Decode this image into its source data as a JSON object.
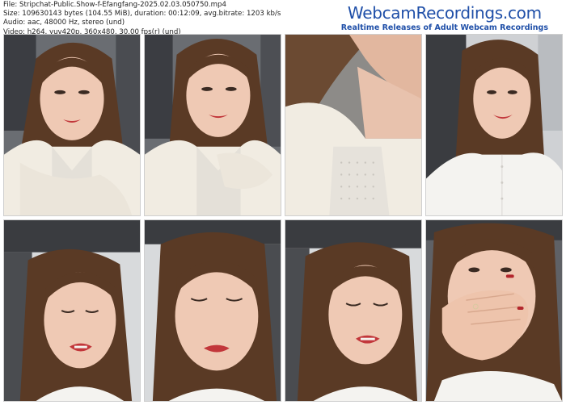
{
  "file_info": {
    "line1": "File: Stripchat-Public.Show-f-Efangfang-2025.02.03.050750.mp4",
    "line2": "Size: 109630143 bytes (104.55 MiB), duration: 00:12:09, avg.bitrate: 1203 kb/s",
    "line3": "Audio: aac, 48000 Hz, stereo (und)",
    "line4": "Video: h264, yuv420p, 360x480, 30.00 fps(r) (und)"
  },
  "brand": {
    "name": "WebcamRecordings.com",
    "tagline": "Realtime Releases of Adult Webcam Recordings"
  },
  "thumbnails": [
    {
      "name": "thumbnail-1",
      "scene": "woman-cream-scarf-coat"
    },
    {
      "name": "thumbnail-2",
      "scene": "woman-cream-scarf-coat"
    },
    {
      "name": "thumbnail-3",
      "scene": "close-up-neck-sweater"
    },
    {
      "name": "thumbnail-4",
      "scene": "woman-white-blouse-car"
    },
    {
      "name": "thumbnail-5",
      "scene": "woman-car-seat-closeup"
    },
    {
      "name": "thumbnail-6",
      "scene": "woman-car-seat-closeup"
    },
    {
      "name": "thumbnail-7",
      "scene": "woman-car-seat-closeup"
    },
    {
      "name": "thumbnail-8",
      "scene": "woman-hand-over-mouth"
    }
  ],
  "colors": {
    "brand": "#1f4fa8",
    "hair": "#5a3a25",
    "skin": "#efc9b4",
    "lips": "#c2363a",
    "coat": "#f1ece2",
    "car_interior": "#3a3c40"
  }
}
